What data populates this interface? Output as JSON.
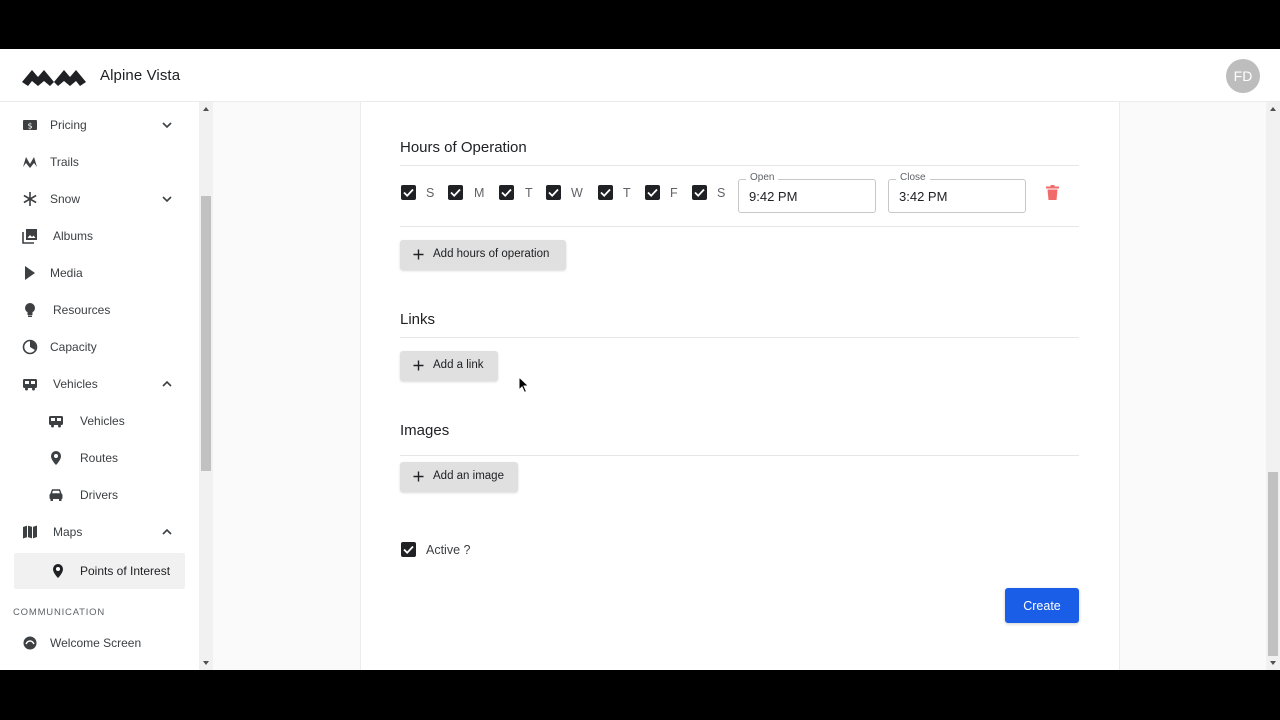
{
  "header": {
    "brand": "Alpine Vista",
    "avatar_initials": "FD"
  },
  "sidebar": {
    "items": [
      {
        "label": "Pricing",
        "icon": "dollar-icon",
        "expandable": true,
        "expanded": false
      },
      {
        "label": "Trails",
        "icon": "hiker-icon"
      },
      {
        "label": "Snow",
        "icon": "snowflake-icon",
        "expandable": true,
        "expanded": false
      },
      {
        "label": "Albums",
        "icon": "photo-library-icon"
      },
      {
        "label": "Media",
        "icon": "play-icon"
      },
      {
        "label": "Resources",
        "icon": "lightbulb-icon"
      },
      {
        "label": "Capacity",
        "icon": "gauge-icon"
      },
      {
        "label": "Vehicles",
        "icon": "bus-icon",
        "expandable": true,
        "expanded": true
      },
      {
        "label": "Vehicles",
        "icon": "bus-icon",
        "sub": true
      },
      {
        "label": "Routes",
        "icon": "location-pin-icon",
        "sub": true
      },
      {
        "label": "Drivers",
        "icon": "car-icon",
        "sub": true
      },
      {
        "label": "Maps",
        "icon": "map-icon",
        "expandable": true,
        "expanded": true
      },
      {
        "label": "Points of Interest",
        "icon": "place-icon",
        "sub": true,
        "selected": true
      }
    ],
    "section_communication": "COMMUNICATION",
    "welcome_screen": "Welcome Screen"
  },
  "hours": {
    "title": "Hours of Operation",
    "days": [
      {
        "letter": "S",
        "checked": true
      },
      {
        "letter": "M",
        "checked": true
      },
      {
        "letter": "T",
        "checked": true
      },
      {
        "letter": "W",
        "checked": true
      },
      {
        "letter": "T",
        "checked": true
      },
      {
        "letter": "F",
        "checked": true
      },
      {
        "letter": "S",
        "checked": true
      }
    ],
    "open_label": "Open",
    "open_value": "9:42 PM",
    "close_label": "Close",
    "close_value": "3:42 PM",
    "add_label": "Add hours of operation"
  },
  "links": {
    "title": "Links",
    "add_label": "Add a link"
  },
  "images": {
    "title": "Images",
    "add_label": "Add an image"
  },
  "active": {
    "label": "Active ?",
    "checked": true
  },
  "actions": {
    "create_label": "Create"
  },
  "colors": {
    "primary": "#1a5ee8",
    "delete": "#f26b6b",
    "checkbox": "#202124"
  }
}
